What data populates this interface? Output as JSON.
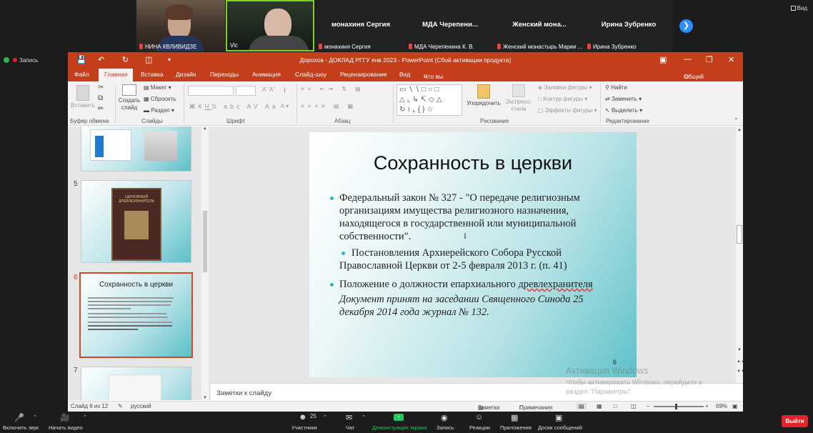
{
  "zoom_top": {
    "participants": [
      {
        "name": "НИНА КВЛИВИДЗЕ"
      },
      {
        "name": "Vic"
      },
      {
        "banner": "монахиня Сергия",
        "name": "монахиня Сергия"
      },
      {
        "banner": "МДА  Черепени...",
        "name": "МДА Черепенина К. В."
      },
      {
        "banner": "Женский  мона...",
        "name": "Женский монастырь Марии ..."
      },
      {
        "banner": "Ирина Зубренко",
        "name": "Ирина Зубренко"
      }
    ],
    "view_label": "Вид",
    "record_label": "Запись"
  },
  "ppt": {
    "window_title": "Дорохов - ДОКЛАД РГГУ янв 2023 - PowerPoint (Сбой активации продукта)",
    "tabs": [
      "Файл",
      "Главная",
      "Вставка",
      "Дизайн",
      "Переходы",
      "Анимация",
      "Слайд-шоу",
      "Рецензирование",
      "Вид"
    ],
    "tell_me": "Что вы хотите сделать?",
    "share": "Общий доступ",
    "ribbon": {
      "paste": "Вставить",
      "create_slide_1": "Создать",
      "create_slide_2": "слайд",
      "layout": "Макет",
      "reset": "Сбросить",
      "section": "Раздел",
      "arrange": "Упорядочить",
      "express_1": "Экспресс-",
      "express_2": "стили",
      "shape_fill": "Заливка фигуры",
      "shape_outline": "Контур фигуры",
      "shape_effects": "Эффекты фигуры",
      "find": "Найти",
      "replace": "Заменить",
      "select": "Выделить",
      "groups": [
        "Буфер обмена",
        "Слайды",
        "Шрифт",
        "Абзац",
        "Рисование",
        "Редактирование"
      ]
    },
    "thumbnails": {
      "n5": "5",
      "n6": "6",
      "n7": "7",
      "book_title": "ЦЕРКОВНЫЙ ДРЕВЛЕХРАНИТЕЛЬ",
      "thumb6_title": "Сохранность в церкви"
    },
    "slide": {
      "title": "Сохранность в церкви",
      "bullet1_l1": "Федеральный закон №  327 - \"О передаче религиозным",
      "bullet1_l2": "организациям имущества религиозного назначения,",
      "bullet1_l3": "находящегося в государственной или муниципальной",
      "bullet1_l4": "собственности\".",
      "bullet2_l1": "Постановления Архиерейского Собора Русской",
      "bullet2_l2": "Православной Церкви от 2-5 февраля 2013 г. (п. 41)",
      "bullet3_l1": "Положение о должности епархиального ",
      "bullet3_word": "древлехранителя",
      "bullet3_l2": "Документ принят на заседании Священного Синода 25",
      "bullet3_l3": "декабря 2014 года журнал № 132.",
      "page": "6"
    },
    "notes_placeholder": "Заметки к слайду",
    "status": {
      "slide_count": "Слайд 6 из 12",
      "language": "русский",
      "notes": "Заметки",
      "comments": "Примечания",
      "zoom": "69%"
    },
    "watermark_title": "Активация Windows",
    "watermark_text_1": "Чтобы активировать Windows, перейдите в",
    "watermark_text_2": "раздел \"Параметры\"."
  },
  "zoom_bottom": {
    "mute": "Включить звук",
    "video": "Начать видео",
    "participants_count": "25",
    "participants": "Участники",
    "chat": "Чат",
    "share": "Демонстрация экрана",
    "record": "Запись",
    "reactions": "Реакции",
    "apps": "Приложения",
    "whiteboards": "Доски сообщений",
    "leave": "Выйти"
  },
  "colors": {
    "ppt_accent": "#c43e1c",
    "zoom_bg": "#1c1c1c",
    "leave_red": "#e5212b",
    "share_green": "#22c55e",
    "bullet_teal": "#2bb5c8"
  }
}
